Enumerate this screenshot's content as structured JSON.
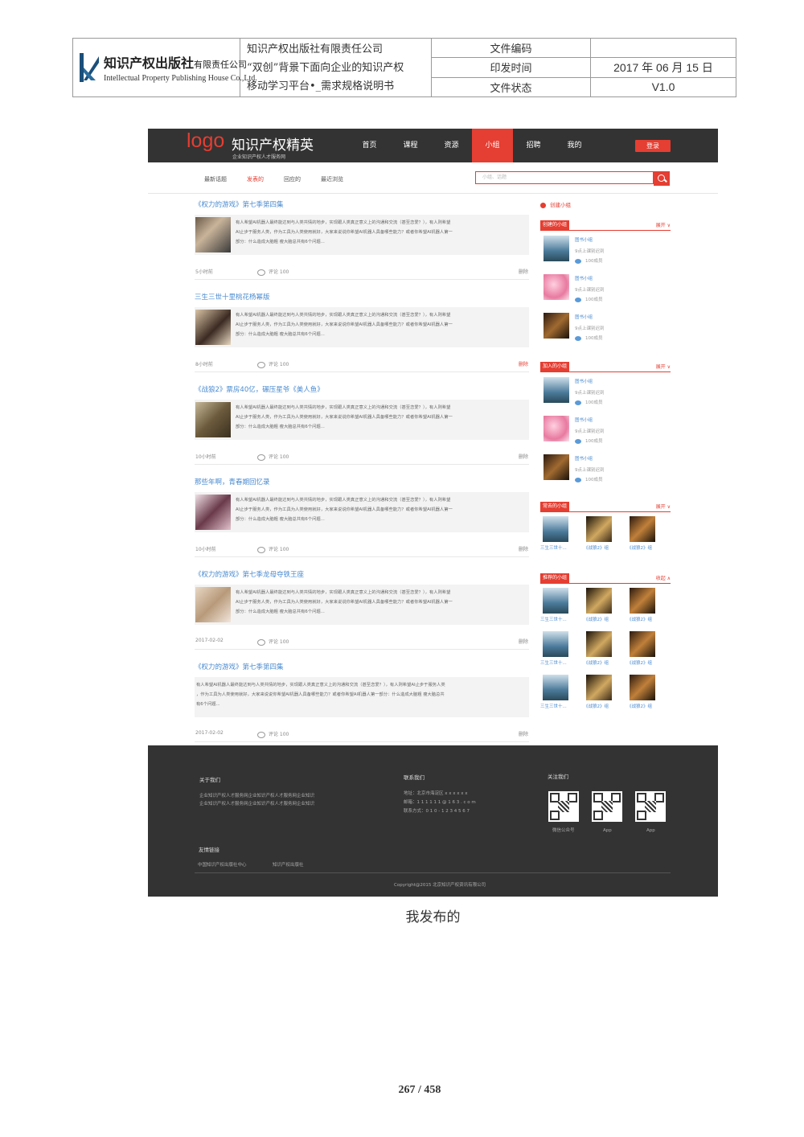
{
  "doc_header": {
    "company_name": "知识产权出版社",
    "company_suffix": "有限责任公司",
    "company_en": "Intellectual Property Publishing House Co.,Ltd.",
    "publisher": "知识产权出版社有限责任公司",
    "title_line1": "“双创”背景下面向企业的知识产权",
    "title_line2": "移动学习平台•_需求规格说明书",
    "label_code": "文件编码",
    "label_date": "印发时间",
    "label_status": "文件状态",
    "value_code": "",
    "value_date": "2017 年 06 月 15 日",
    "value_status": "V1.0"
  },
  "site": {
    "logo": "logo",
    "name": "知识产权精英",
    "subtitle": "企业知识产权人才服务网",
    "nav": [
      "首页",
      "课程",
      "资源",
      "小组",
      "招聘",
      "我的"
    ],
    "nav_active": 3,
    "login": "登录",
    "subtabs": [
      "最新话题",
      "发表的",
      "回应的",
      "最近浏览"
    ],
    "subtab_active": 1,
    "search_placeholder": "小组、话题"
  },
  "posts": [
    {
      "title": "《权力的游戏》第七季第四集",
      "time": "5小时前",
      "comment": "评论 100",
      "delete": "删除",
      "has_image": true
    },
    {
      "title": "三生三世十里桃花杨幂版",
      "time": "8小时前",
      "comment": "评论 100",
      "delete": "删除",
      "has_image": true
    },
    {
      "title": "《战狼2》票房40亿，碾压星爷《美人鱼》",
      "time": "10小时前",
      "comment": "评论 100",
      "delete": "删除",
      "has_image": true
    },
    {
      "title": "那些年啊，青春期回忆录",
      "time": "10小时前",
      "comment": "评论 100",
      "delete": "删除",
      "has_image": true
    },
    {
      "title": "《权力的游戏》第七季龙母夺铁王座",
      "time": "2017-02-02",
      "comment": "评论 100",
      "delete": "删除",
      "has_image": true
    },
    {
      "title": "《权力的游戏》第七季第四集",
      "time": "2017-02-02",
      "comment": "评论 100",
      "delete": "删除",
      "has_image": false
    }
  ],
  "post_text": {
    "l1": "有人希望AI机器人最终能达到与人类共情的地步，实现跟人类真正意义上的沟通和交流（甚至恋爱？），有人则希望",
    "l2": "AI止步于服务人类，作为工具为人类使用就好，大家来说说你希望AI机器人具备哪些能力？或者你希望AI机器人第一",
    "l3": "部分：什么造成大脑粗 瘦大脑总共有6个问题...",
    "w1": "有人希望AI机器人最终能达到与人类共情的地步，实现跟人类真正意义上的沟通和交流（甚至恋爱？），有人则希望AI止步于服务人类",
    "w2": "，作为工具为人类使用就好，大家来说说你希望AI机器人具备哪些能力？或者你希望AI机器人第一部分：什么造成大脑粗 瘦大脑总共",
    "w3": "有6个问题..."
  },
  "sidebar": {
    "create": "创建小组",
    "sections": [
      {
        "title": "创建的小组",
        "more": "展开 ∨"
      },
      {
        "title": "加入的小组",
        "more": "展开 ∨"
      },
      {
        "title": "常去的小组",
        "more": "展开 ∨"
      },
      {
        "title": "推荐的小组",
        "more": "收起 ∧"
      }
    ],
    "group_name": "图书小组",
    "group_desc": "9点上课别迟到",
    "group_count": "100成员",
    "tile_labels": [
      "三生三世十...",
      "《战狼2》组",
      "《战狼2》组"
    ]
  },
  "footer": {
    "about_title": "关于我们",
    "about_l1": "企业知识产权人才服务网企业知识产权人才服务网企业知识",
    "about_l2": "企业知识产权人才服务网企业知识产权人才服务网企业知识",
    "contact_title": "联系我们",
    "contact_addr": "地址：北京市海淀区 x x x x x x",
    "contact_mail": "邮箱：1 1 1 1 1 1 @ 1 6 3 . c o m",
    "contact_phone": "联系方式：0 1 0 - 1 2 3 4 5 6 7",
    "follow_title": "关注我们",
    "qr_labels": [
      "微信公众号",
      "App",
      "App"
    ],
    "links_title": "友情链接",
    "link1": "中国知识产权出版社中心",
    "link2": "知识产权出版社",
    "copyright": "Copyright@2015  北京知识产权资讯有限公司"
  },
  "caption": "我发布的",
  "page_number": "267 / 458",
  "colors": {
    "accent": "#e53e32",
    "link": "#4a8bd0",
    "bar": "#333333"
  }
}
